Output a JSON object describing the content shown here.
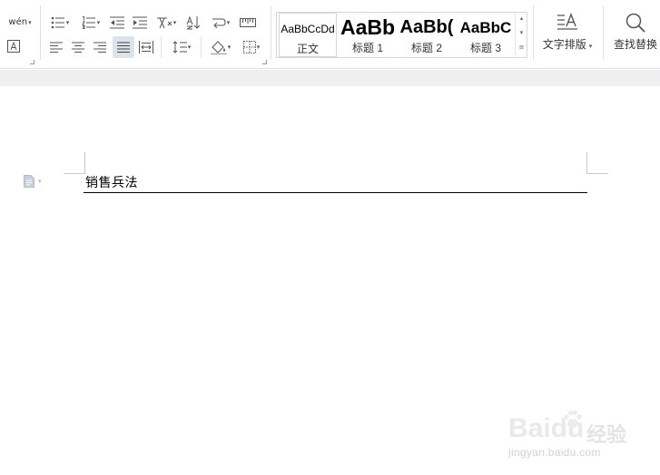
{
  "ribbon": {
    "phonetic_glyph": "wén",
    "styles": {
      "normal": {
        "preview": "AaBbCcDd",
        "label": "正文"
      },
      "heading1": {
        "preview": "AaBb",
        "label": "标题 1"
      },
      "heading2": {
        "preview": "AaBb(",
        "label": "标题 2"
      },
      "heading3": {
        "preview": "AaBbC",
        "label": "标题 3"
      }
    },
    "text_layout_label": "文字排版",
    "find_replace_label": "查找替换"
  },
  "document": {
    "title": "销售兵法"
  },
  "watermark": {
    "logo": "Baidu",
    "product": "经验",
    "url": "jingyan.baidu.com"
  },
  "colors": {
    "ribbon_bg": "#ffffff",
    "band_bg": "#eeeff1",
    "active_button": "#dde3ea",
    "icon_stroke": "#555555"
  }
}
